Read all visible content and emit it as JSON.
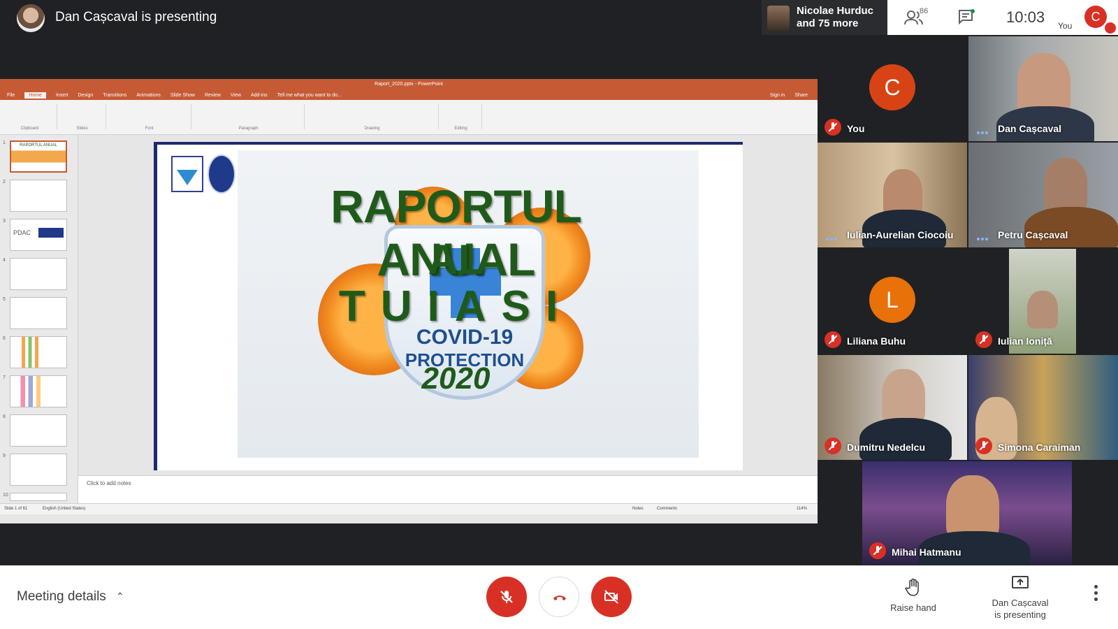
{
  "topbar": {
    "presenting_text": "Dan Cașcaval is presenting",
    "active_speaker_line1": "Nicolae Hurduc",
    "active_speaker_line2": "and 75 more",
    "people_count": "86",
    "clock": "10:03",
    "you_label": "You",
    "self_initial": "C"
  },
  "ppt": {
    "window_title": "Raport_2020.pptx - PowerPoint",
    "tabs": [
      "File",
      "Home",
      "Insert",
      "Design",
      "Transitions",
      "Animations",
      "Slide Show",
      "Review",
      "View",
      "Add-ins",
      "Tell me what you want to do..."
    ],
    "tabs_right": [
      "Sign in",
      "Share"
    ],
    "ribbon_groups": [
      "Clipboard",
      "Slides",
      "Font",
      "Paragraph",
      "Drawing",
      "Editing"
    ],
    "thumb_numbers": [
      "1",
      "2",
      "3",
      "4",
      "5",
      "6",
      "7",
      "8",
      "9",
      "10"
    ],
    "thumb1_text": "RAPORTUL ANUAL",
    "thumb3_text": "PDAC",
    "notes_placeholder": "Click to add notes",
    "status_left": "Slide 1 of 61",
    "status_lang": "English (United States)",
    "status_notes": "Notes",
    "status_comments": "Comments",
    "zoom": "114%"
  },
  "slide": {
    "title": "RAPORTUL ANUAL",
    "al": "AL",
    "tuiasi": "TUIASI",
    "covid_line1": "COVID-19",
    "covid_line2": "PROTECTION",
    "year": "2020"
  },
  "participants": [
    {
      "name": "You",
      "initial": "C",
      "avatar_color": "#d84315",
      "muted": true
    },
    {
      "name": "Dan Cașcaval",
      "muted": false
    },
    {
      "name": "Iulian-Aurelian Ciocoiu",
      "muted": false
    },
    {
      "name": "Petru Cașcaval",
      "muted": false
    },
    {
      "name": "Liliana Buhu",
      "initial": "L",
      "avatar_color": "#e8710a",
      "muted": true
    },
    {
      "name": "Iulian Ioniță",
      "muted": true
    },
    {
      "name": "Dumitru Nedelcu",
      "muted": true
    },
    {
      "name": "Simona Caraiman",
      "muted": true
    },
    {
      "name": "Mihai Hatmanu",
      "muted": true
    }
  ],
  "bottombar": {
    "meeting_details": "Meeting details",
    "raise_hand": "Raise hand",
    "presenting_line1": "Dan Cașcaval",
    "presenting_line2": "is presenting"
  },
  "colors": {
    "danger": "#d93025",
    "ppt_accent": "#c55a35",
    "background": "#202124"
  }
}
